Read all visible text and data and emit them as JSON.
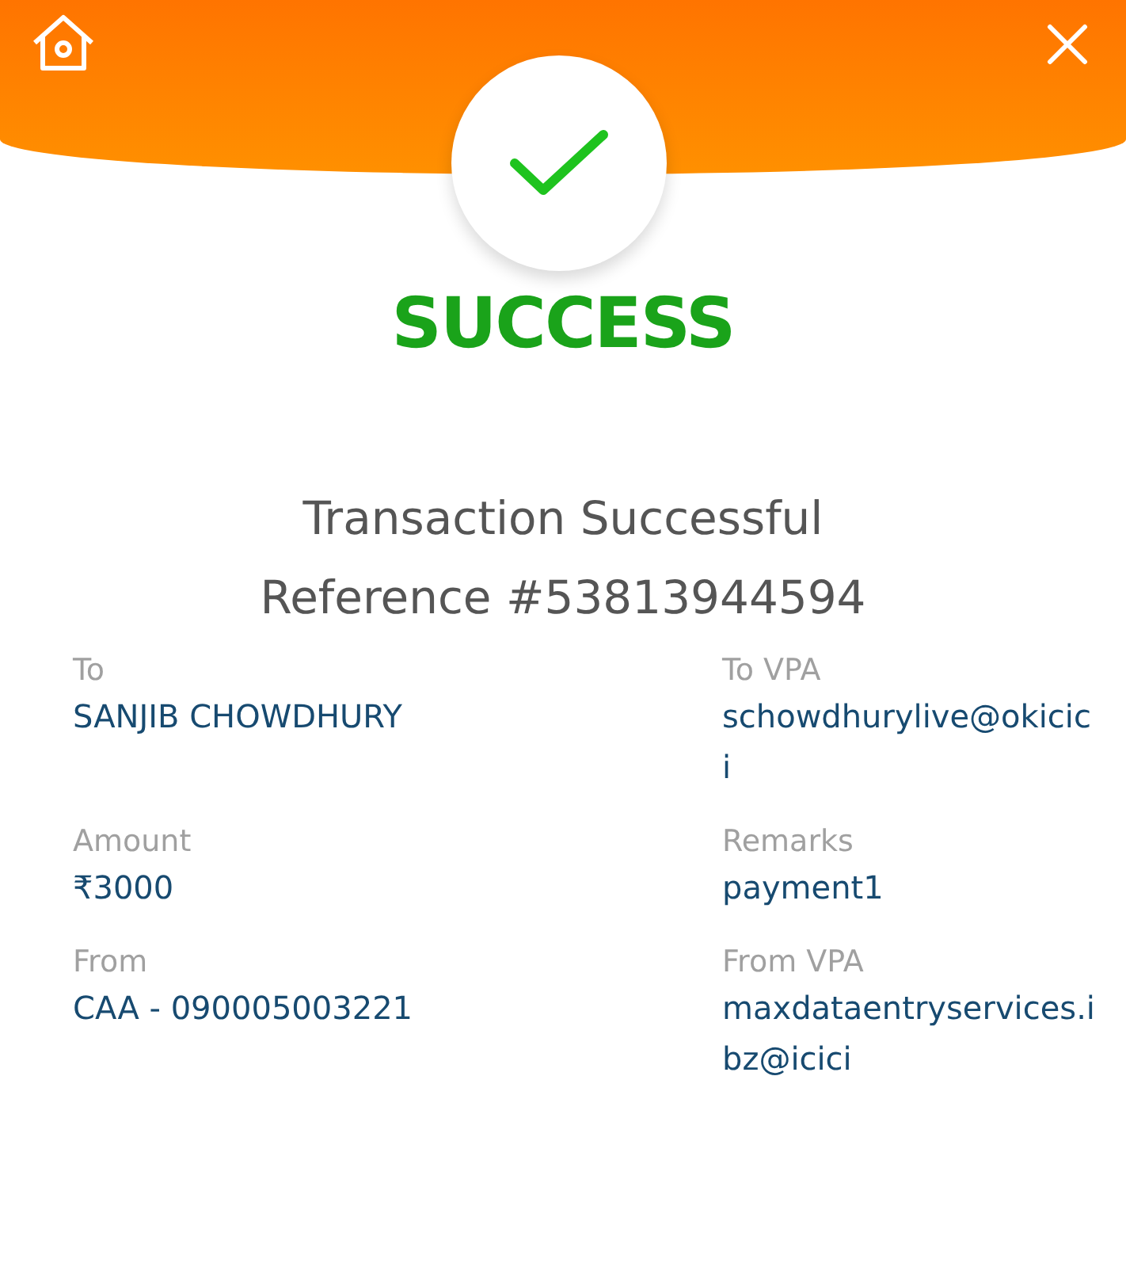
{
  "header": {
    "status": "SUCCESS",
    "success": true
  },
  "message": "Transaction Successful",
  "reference": "Reference #53813944594",
  "details": [
    {
      "label": "To",
      "value": "SANJIB CHOWDHURY"
    },
    {
      "label": "To VPA",
      "value": "schowdhurylive@okicici"
    },
    {
      "label": "Amount",
      "value": "₹3000"
    },
    {
      "label": "Remarks",
      "value": "payment1"
    },
    {
      "label": "From",
      "value": "CAA - 090005003221"
    },
    {
      "label": "From VPA",
      "value": "maxdataentryservices.ibz@icici"
    }
  ]
}
